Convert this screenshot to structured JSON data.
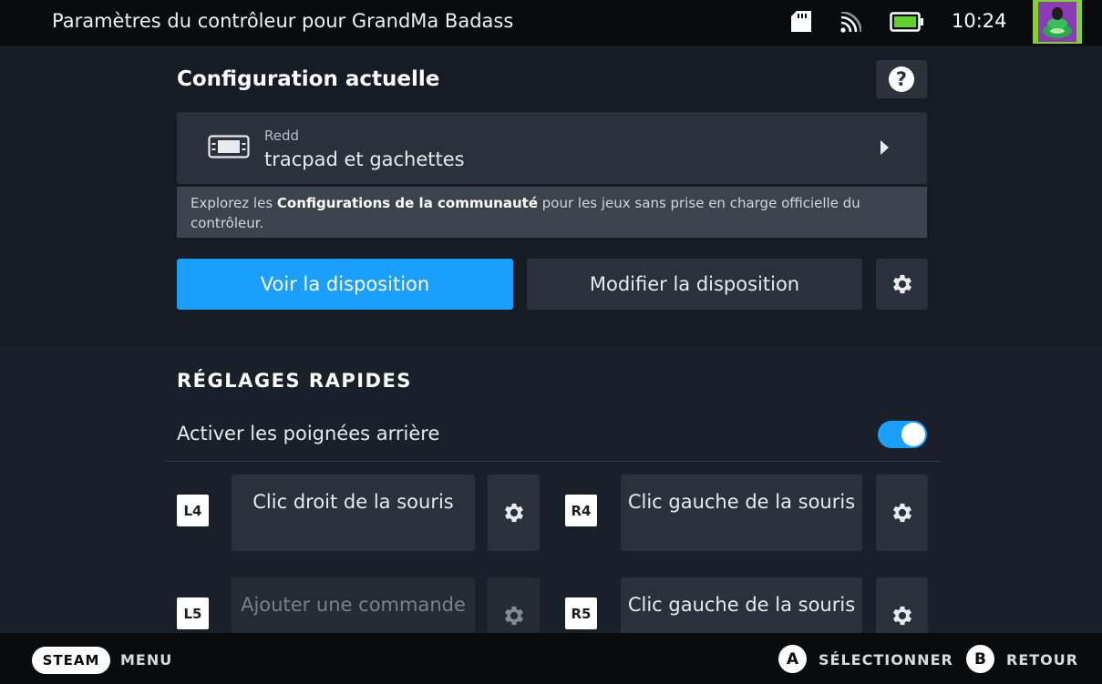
{
  "topbar": {
    "title": "Paramètres du contrôleur pour GrandMa Badass",
    "clock": "10:24"
  },
  "current_config": {
    "heading": "Configuration actuelle",
    "help_label": "?",
    "author": "Redd",
    "name": "tracpad et gachettes",
    "note_prefix": "Explorez les ",
    "note_bold": "Configurations de la communauté",
    "note_suffix": " pour les jeux sans prise en charge officielle du contrôleur.",
    "view_layout_label": "Voir la disposition",
    "edit_layout_label": "Modifier la disposition"
  },
  "quick_settings": {
    "heading": "RÉGLAGES RAPIDES",
    "back_grips_label": "Activer les poignées arrière",
    "back_grips_enabled": true,
    "bindings": [
      {
        "key": "L4",
        "action": "Clic droit de la souris"
      },
      {
        "key": "R4",
        "action": "Clic gauche de la souris"
      },
      {
        "key": "L5",
        "action": "Ajouter une commande"
      },
      {
        "key": "R5",
        "action": "Clic gauche de la souris"
      }
    ]
  },
  "footer": {
    "steam_label": "STEAM",
    "menu_label": "MENU",
    "a_glyph": "A",
    "select_label": "SÉLECTIONNER",
    "b_glyph": "B",
    "back_label": "RETOUR"
  },
  "colors": {
    "accent": "#1a9fff",
    "battery": "#5fd12c",
    "panel": "#2b313a"
  },
  "icons": [
    "sd-card-icon",
    "wifi-icon",
    "battery-icon",
    "avatar",
    "help-icon",
    "controller-icon",
    "chevron-right-icon",
    "gear-icon"
  ]
}
